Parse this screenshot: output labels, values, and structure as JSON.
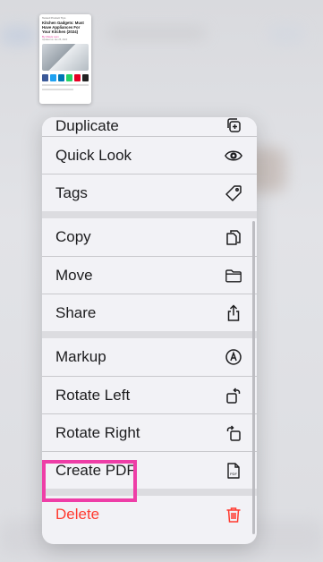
{
  "preview": {
    "top_text": "Tested Product Tips",
    "title": "Kitchen Gadgets: Must Have Appliances For Your Kitchen (2024)",
    "author": "By Mavis Lam",
    "meta": "Updated on Jan 25, 2024"
  },
  "menu": {
    "groups": [
      [
        {
          "label": "Duplicate",
          "icon": "duplicate-icon"
        },
        {
          "label": "Quick Look",
          "icon": "eye-icon"
        },
        {
          "label": "Tags",
          "icon": "tag-icon"
        }
      ],
      [
        {
          "label": "Copy",
          "icon": "copy-icon"
        },
        {
          "label": "Move",
          "icon": "folder-icon"
        },
        {
          "label": "Share",
          "icon": "share-icon"
        }
      ],
      [
        {
          "label": "Markup",
          "icon": "markup-icon"
        },
        {
          "label": "Rotate Left",
          "icon": "rotate-left-icon"
        },
        {
          "label": "Rotate Right",
          "icon": "rotate-right-icon"
        },
        {
          "label": "Create PDF",
          "icon": "pdf-doc-icon"
        }
      ],
      [
        {
          "label": "Delete",
          "icon": "trash-icon"
        }
      ]
    ]
  },
  "colors": {
    "danger": "#ff3b30",
    "highlight": "#ee3ea7",
    "text": "#1c1c1e"
  }
}
